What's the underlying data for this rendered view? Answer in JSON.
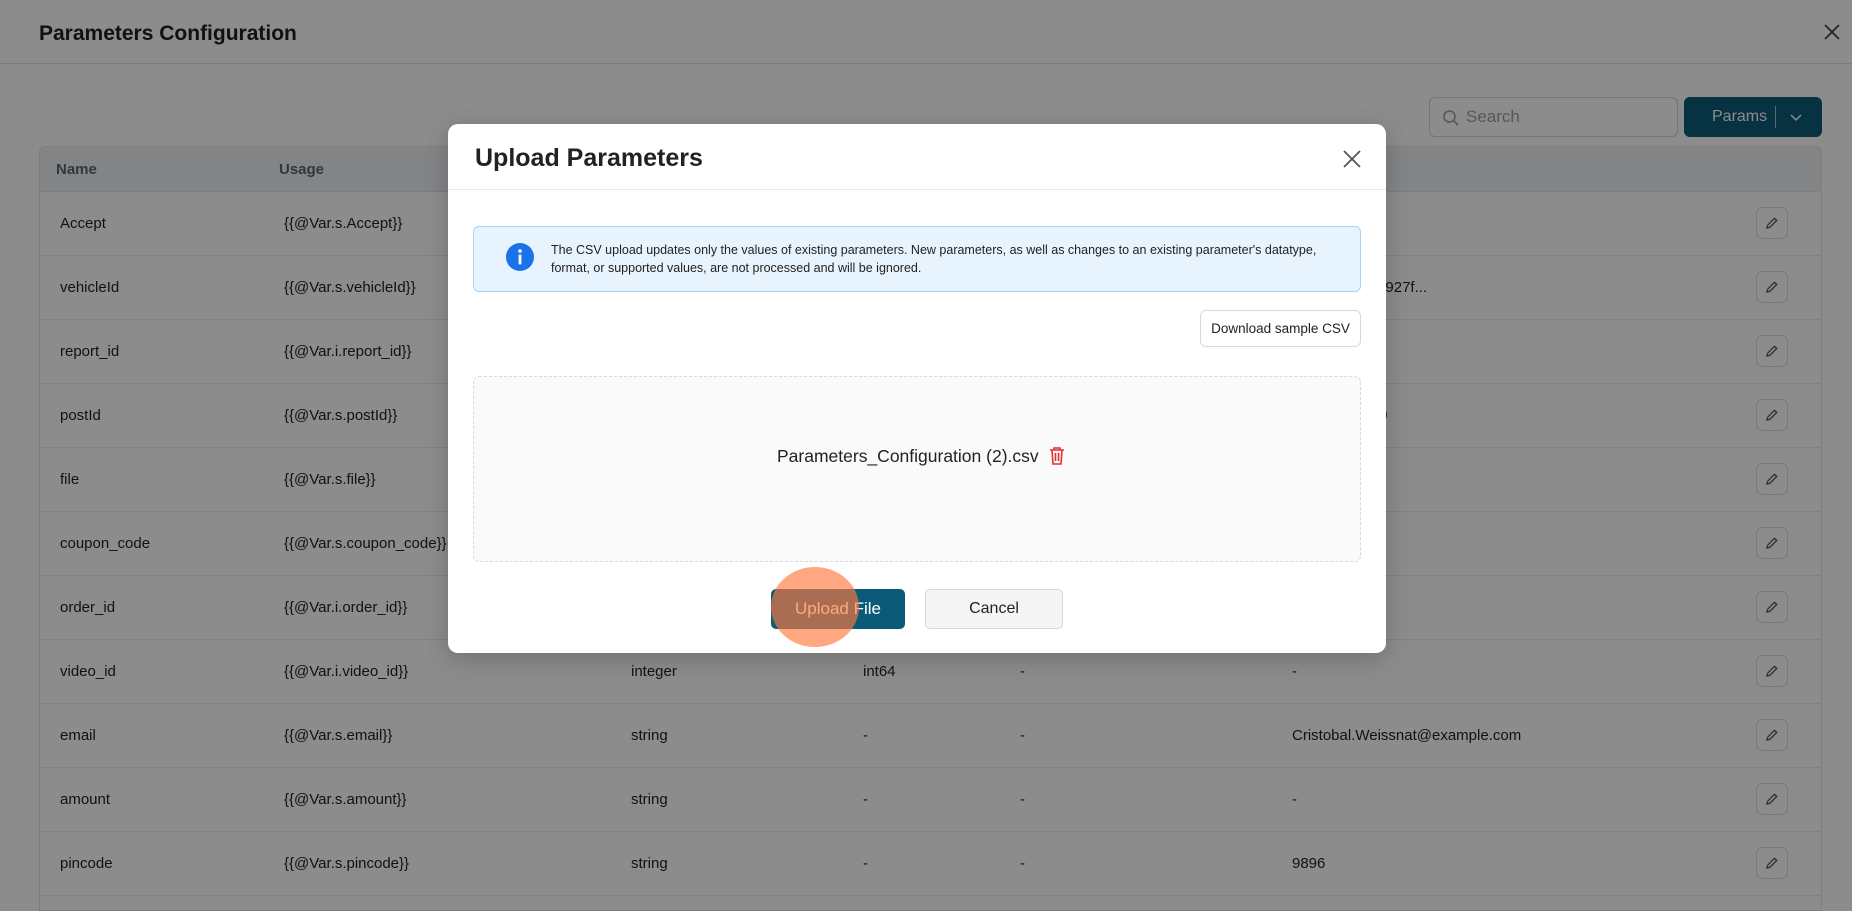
{
  "page": {
    "title": "Parameters Configuration",
    "search_placeholder": "Search",
    "params_button": "Params",
    "columns": [
      "Name",
      "Usage"
    ],
    "rows": [
      {
        "name": "Accept",
        "usage": "{{@Var.s.Accept}}",
        "type": "",
        "format": "",
        "supported": "",
        "value": ""
      },
      {
        "name": "vehicleId",
        "usage": "{{@Var.s.vehicleId}}",
        "type": "",
        "format": "",
        "supported": "",
        "value": "l-44aa-af0b-af927f..."
      },
      {
        "name": "report_id",
        "usage": "{{@Var.i.report_id}}",
        "type": "",
        "format": "",
        "supported": "",
        "value": ""
      },
      {
        "name": "postId",
        "usage": "{{@Var.s.postId}}",
        "type": "",
        "format": "",
        "supported": "",
        "value": "tvYSLWPsqu9"
      },
      {
        "name": "file",
        "usage": "{{@Var.s.file}}",
        "type": "",
        "format": "",
        "supported": "",
        "value": ""
      },
      {
        "name": "coupon_code",
        "usage": "{{@Var.s.coupon_code}}",
        "type": "",
        "format": "",
        "supported": "",
        "value": ""
      },
      {
        "name": "order_id",
        "usage": "{{@Var.i.order_id}}",
        "type": "",
        "format": "",
        "supported": "",
        "value": ""
      },
      {
        "name": "video_id",
        "usage": "{{@Var.i.video_id}}",
        "type": "integer",
        "format": "int64",
        "supported": "-",
        "value": "-"
      },
      {
        "name": "email",
        "usage": "{{@Var.s.email}}",
        "type": "string",
        "format": "-",
        "supported": "-",
        "value": "Cristobal.Weissnat@example.com"
      },
      {
        "name": "amount",
        "usage": "{{@Var.s.amount}}",
        "type": "string",
        "format": "-",
        "supported": "-",
        "value": "-"
      },
      {
        "name": "pincode",
        "usage": "{{@Var.s.pincode}}",
        "type": "string",
        "format": "-",
        "supported": "-",
        "value": "9896"
      }
    ]
  },
  "modal": {
    "title": "Upload Parameters",
    "info": "The CSV upload updates only the values of existing parameters. New parameters, as well as changes to an existing parameter's datatype, format, or supported values, are not processed and will be ignored.",
    "download_label": "Download sample CSV",
    "file_name": "Parameters_Configuration (2).csv",
    "upload_label": "Upload File",
    "cancel_label": "Cancel"
  },
  "colors": {
    "primary": "#0b5b78",
    "info_bg": "#e8f4fd",
    "info_icon": "#1a73e8",
    "danger": "#e03131",
    "click_marker": "#ff7a3c"
  }
}
